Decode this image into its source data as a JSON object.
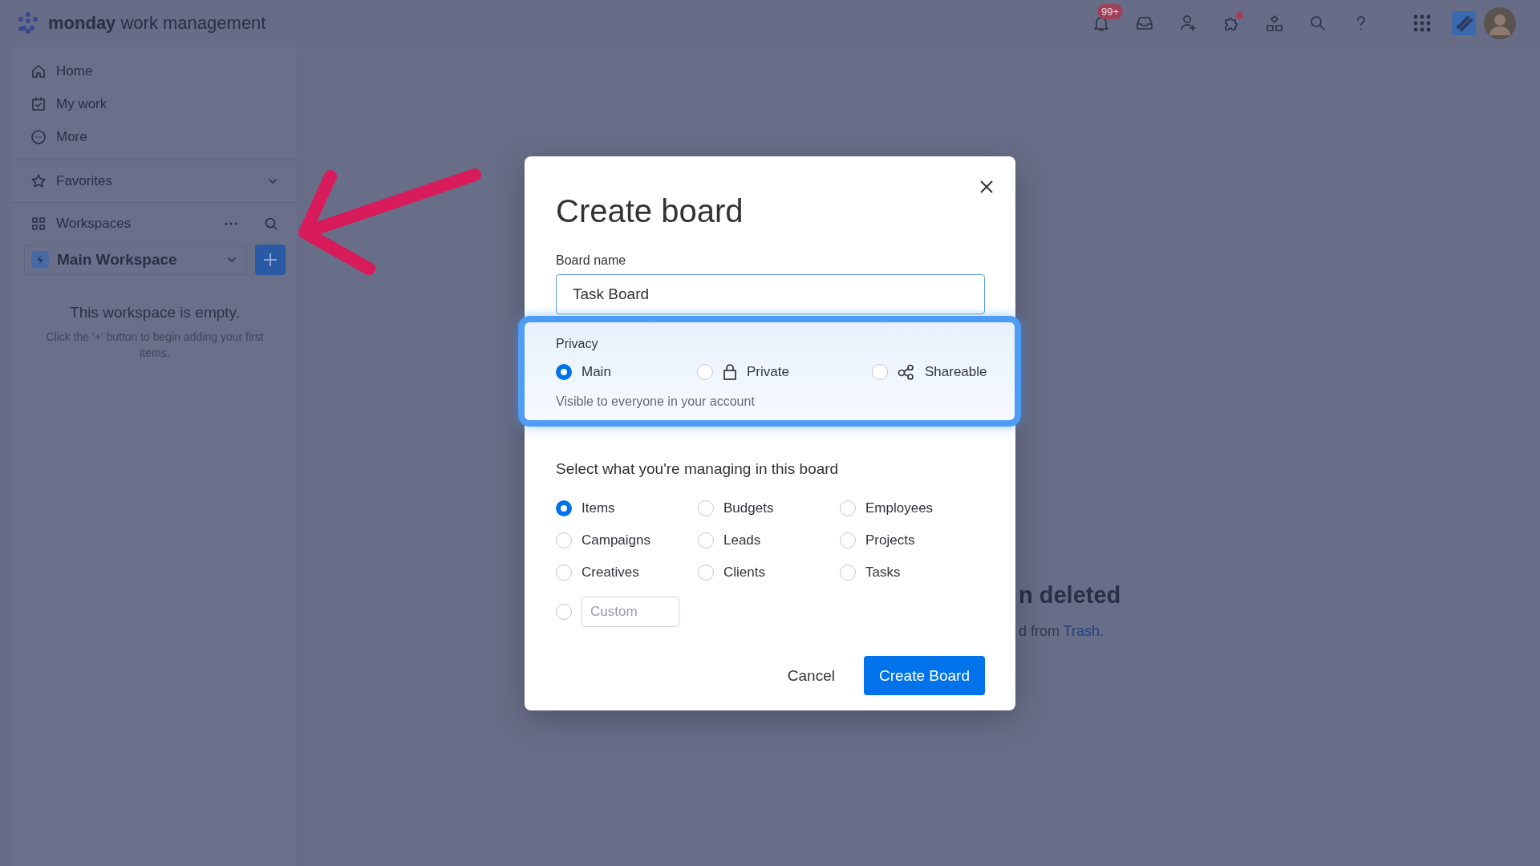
{
  "top_bar": {
    "brand": "monday",
    "product": "work management",
    "notification_badge": "99+"
  },
  "sidebar": {
    "nav": [
      {
        "label": "Home"
      },
      {
        "label": "My work"
      },
      {
        "label": "More"
      }
    ],
    "favorites": {
      "label": "Favorites"
    },
    "workspaces": {
      "label": "Workspaces"
    },
    "workspace": {
      "name": "Main Workspace"
    },
    "empty_title": "This workspace is empty.",
    "empty_hint": "Click the '+' button to begin adding your first items."
  },
  "background": {
    "heading": "n deleted",
    "hint": "d from ",
    "link": "Trash."
  },
  "dialog": {
    "title": "Create board",
    "board_name": {
      "label": "Board name",
      "value": "Task Board"
    },
    "privacy": {
      "label": "Privacy",
      "options": [
        {
          "label": "Main",
          "kind": "plain",
          "selected": true
        },
        {
          "label": "Private",
          "kind": "lock",
          "selected": false
        },
        {
          "label": "Shareable",
          "kind": "share",
          "selected": false
        }
      ],
      "description": "Visible to everyone in your account"
    },
    "managing": {
      "label": "Select what you're managing in this board",
      "options": [
        {
          "label": "Items",
          "selected": true
        },
        {
          "label": "Budgets",
          "selected": false
        },
        {
          "label": "Employees",
          "selected": false
        },
        {
          "label": "Campaigns",
          "selected": false
        },
        {
          "label": "Leads",
          "selected": false
        },
        {
          "label": "Projects",
          "selected": false
        },
        {
          "label": "Creatives",
          "selected": false
        },
        {
          "label": "Clients",
          "selected": false
        },
        {
          "label": "Tasks",
          "selected": false
        }
      ],
      "custom": {
        "placeholder": "Custom",
        "selected": false
      }
    },
    "cancel": "Cancel",
    "create": "Create Board"
  }
}
